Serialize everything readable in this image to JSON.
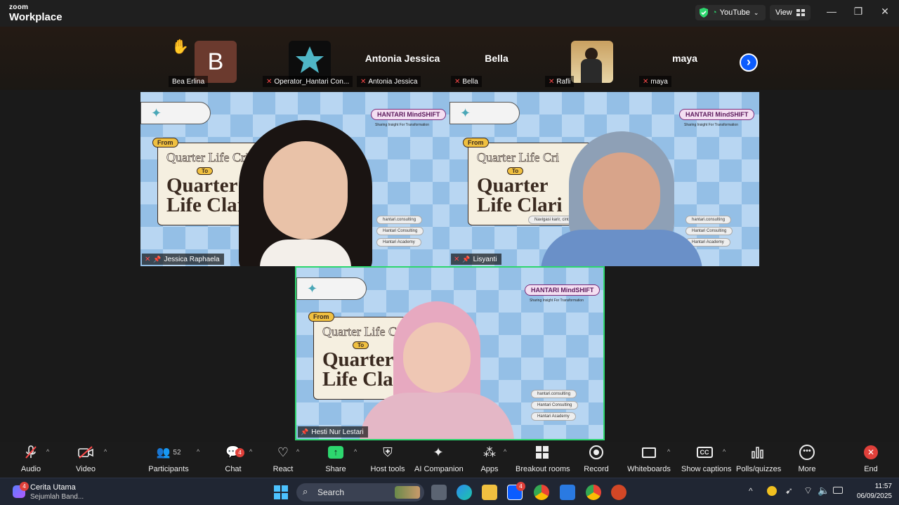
{
  "titlebar": {
    "brand_top": "zoom",
    "brand_bottom": "Workplace",
    "share_source": "YouTube",
    "view_label": "View",
    "minimize": "—",
    "restore": "❐",
    "close": "✕"
  },
  "strip": {
    "raise_hand": "✋",
    "avatar_letter": "B",
    "tiles": [
      {
        "name": "",
        "label": "Bea Erlina"
      },
      {
        "name": "",
        "label": "Operator_Hantari Con..."
      },
      {
        "name": "Antonia Jessica",
        "label": "Antonia Jessica"
      },
      {
        "name": "Bella",
        "label": "Bella"
      },
      {
        "name": "",
        "label": "Rafli"
      },
      {
        "name": "maya",
        "label": "maya"
      }
    ],
    "next_arrow": "›"
  },
  "videos": [
    {
      "name": "Jessica Raphaela"
    },
    {
      "name": "Lisyanti"
    },
    {
      "name": "Hesti Nur Lestari"
    }
  ],
  "poster": {
    "from": "From",
    "line1": "Quarter Life Cri",
    "to": "To",
    "line2a": "Quarter",
    "line2b": "Life Clari",
    "badge": "HANTARI MindSHIFT",
    "badge_sub": "Sharing Insight For Transformation",
    "logo_text": "HANTARI",
    "social1": "hantari.consulting",
    "social2": "Hantari Consulting",
    "social3": "Hantari Academy",
    "tagline": "Navigasi karir, cinta,"
  },
  "toolbar": {
    "audio": "Audio",
    "video": "Video",
    "participants": "Participants",
    "participants_count": "52",
    "chat": "Chat",
    "chat_badge": "4",
    "react": "React",
    "share": "Share",
    "host_tools": "Host tools",
    "ai_companion": "AI Companion",
    "apps": "Apps",
    "breakout": "Breakout rooms",
    "record": "Record",
    "whiteboards": "Whiteboards",
    "captions": "Show captions",
    "polls": "Polls/quizzes",
    "more": "More",
    "end": "End"
  },
  "taskbar": {
    "news_badge": "4",
    "news_title": "Cerita Utama",
    "news_sub": "Sejumlah Band...",
    "search": "Search",
    "zoom_badge": "4",
    "time": "11:57",
    "date": "06/09/2025"
  },
  "colors": {
    "accent_green": "#2dd66e",
    "mute_red": "#ff4a4a",
    "zoom_blue": "#0b5cff"
  }
}
